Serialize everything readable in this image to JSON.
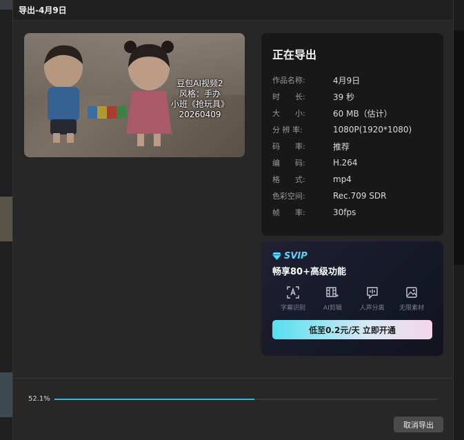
{
  "dialog": {
    "title": "导出-4月9日"
  },
  "preview": {
    "caption": [
      "豆包AI视频2",
      "风格：手办",
      "小班《抢玩具》",
      "20260409"
    ]
  },
  "info": {
    "heading": "正在导出",
    "rows": [
      {
        "label": "作品名称:",
        "value": "4月9日"
      },
      {
        "label": "时　　长:",
        "value": "39 秒"
      },
      {
        "label": "大　　小:",
        "value": "60 MB（估计）"
      },
      {
        "label": "分 辨 率:",
        "value": "1080P(1920*1080)"
      },
      {
        "label": "码　　率:",
        "value": "推荐"
      },
      {
        "label": "编　　码:",
        "value": "H.264"
      },
      {
        "label": "格　　式:",
        "value": "mp4"
      },
      {
        "label": "色彩空间:",
        "value": "Rec.709 SDR"
      },
      {
        "label": "帧　　率:",
        "value": "30fps"
      }
    ]
  },
  "svip": {
    "badge": "SVIP",
    "headline": "畅享80+高级功能",
    "features": [
      {
        "label": "字幕识别",
        "icon": "subtitle-recognition-icon"
      },
      {
        "label": "AI剪辑",
        "icon": "ai-edit-icon"
      },
      {
        "label": "人声分离",
        "icon": "voice-separation-icon"
      },
      {
        "label": "无限素材",
        "icon": "unlimited-assets-icon"
      }
    ],
    "cta": "低至0.2元/天 立即开通",
    "colors": {
      "badge": "#56d6ff",
      "cta_start": "#55dff0",
      "cta_end": "#f6d6ea"
    }
  },
  "progress": {
    "percent_label": "52.1%",
    "value": 0.521,
    "color": "#27c4e0"
  },
  "footer": {
    "cancel_label": "取消导出"
  }
}
